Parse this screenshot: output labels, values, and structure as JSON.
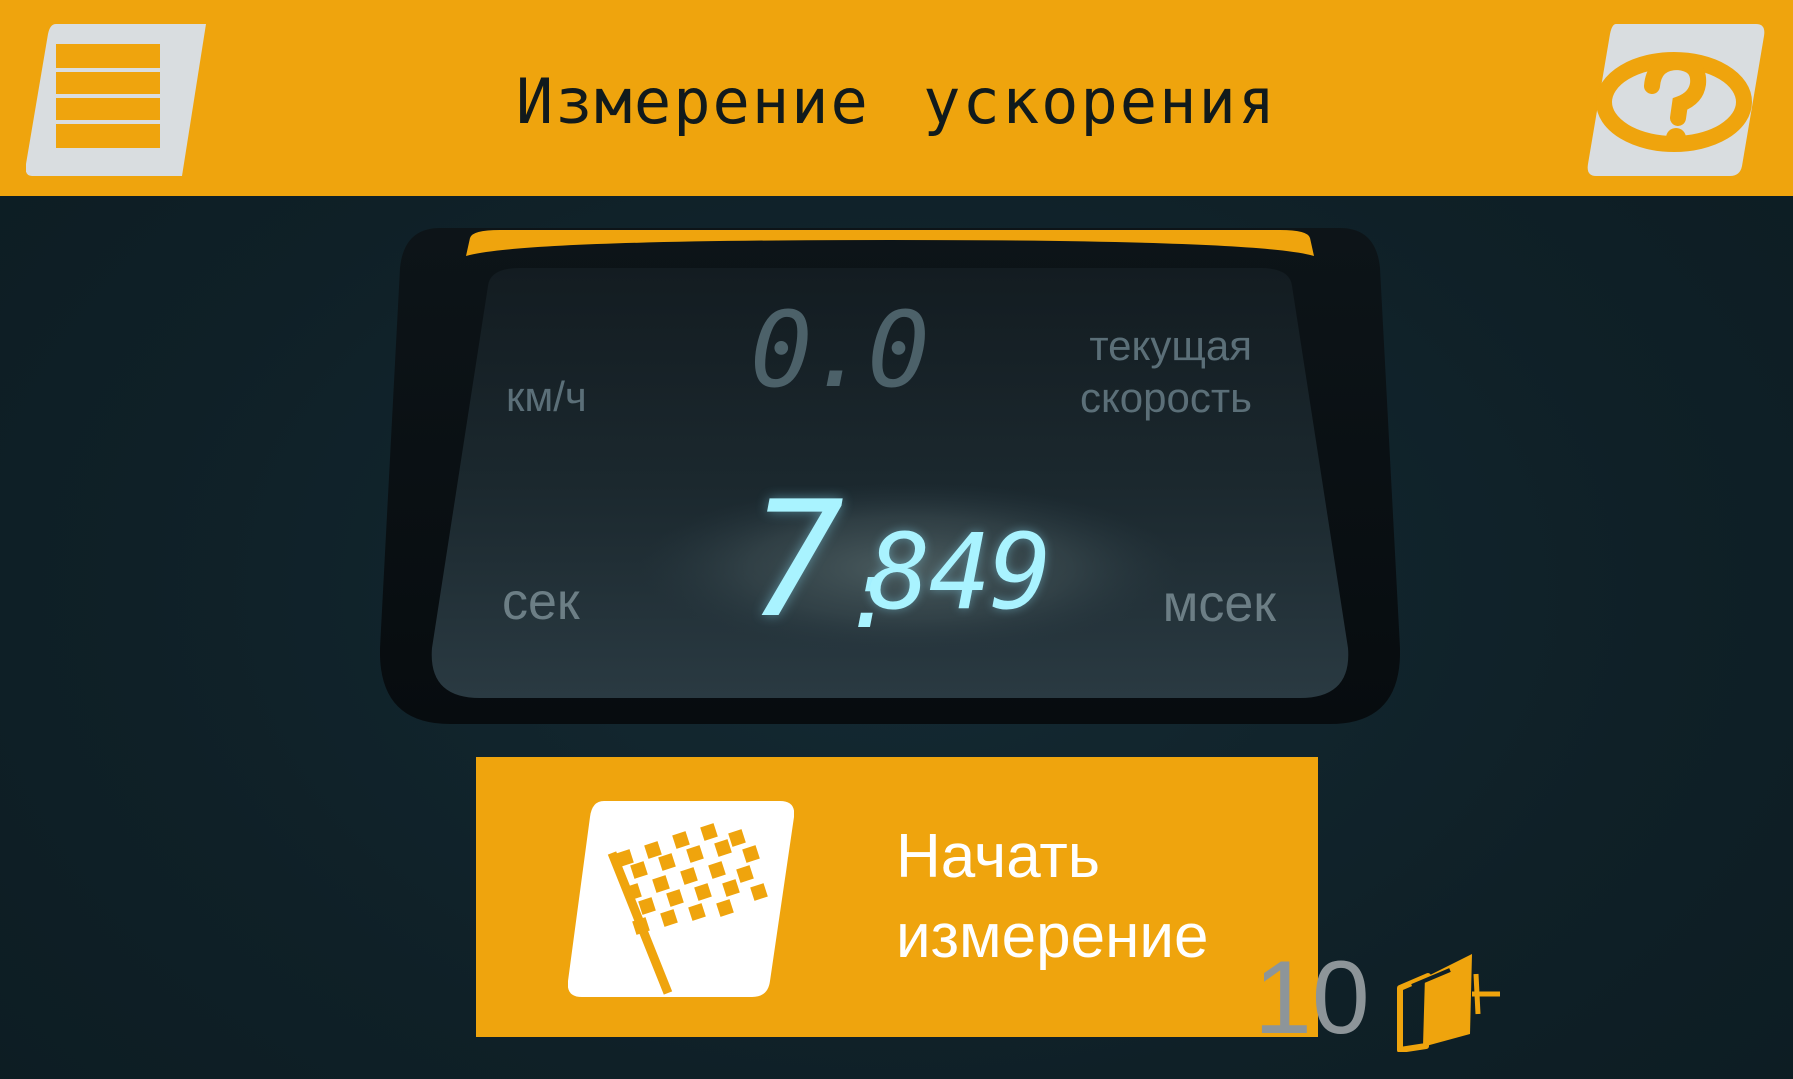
{
  "header": {
    "title": "Измерение  ускорения",
    "menu_icon": "menu-list-icon",
    "help_icon": "help-question-icon"
  },
  "display": {
    "speed_unit": "км/ч",
    "speed_value": "0.0",
    "speed_caption_line1": "текущая",
    "speed_caption_line2": "скорость",
    "time_seconds": "7",
    "time_separator": ":",
    "time_milliseconds": "849",
    "seconds_label": "сек",
    "milliseconds_label": "мсек"
  },
  "start_button": {
    "label_line1": "Начать",
    "label_line2": "измерение",
    "icon": "checkered-flag-icon"
  },
  "volume": {
    "level": "10",
    "icon": "speaker-icon"
  },
  "colors": {
    "accent": "#efa40d",
    "background": "#0f2027",
    "digit_active": "#a9f3ff",
    "digit_inactive": "#4c6169"
  }
}
